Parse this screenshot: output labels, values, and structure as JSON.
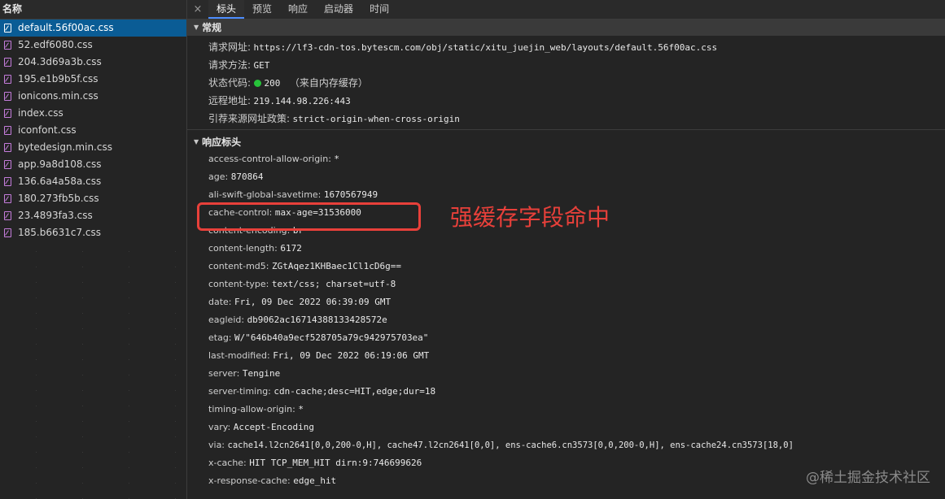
{
  "left_panel": {
    "header": "名称",
    "files": [
      {
        "name": "default.56f00ac.css",
        "selected": true
      },
      {
        "name": "52.edf6080.css"
      },
      {
        "name": "204.3d69a3b.css"
      },
      {
        "name": "195.e1b9b5f.css"
      },
      {
        "name": "ionicons.min.css"
      },
      {
        "name": "index.css"
      },
      {
        "name": "iconfont.css"
      },
      {
        "name": "bytedesign.min.css"
      },
      {
        "name": "app.9a8d108.css"
      },
      {
        "name": "136.6a4a58a.css"
      },
      {
        "name": "180.273fb5b.css"
      },
      {
        "name": "23.4893fa3.css"
      },
      {
        "name": "185.b6631c7.css"
      }
    ]
  },
  "tabs": {
    "close": "×",
    "items": [
      "标头",
      "预览",
      "响应",
      "启动器",
      "时间"
    ],
    "active": "标头"
  },
  "general": {
    "title": "常规",
    "request_url_label": "请求网址:",
    "request_url": "https://lf3-cdn-tos.bytescm.com/obj/static/xitu_juejin_web/layouts/default.56f00ac.css",
    "method_label": "请求方法:",
    "method": "GET",
    "status_label": "状态代码:",
    "status_code": "200",
    "status_note": "（来自内存缓存）",
    "remote_label": "远程地址:",
    "remote": "219.144.98.226:443",
    "referrer_label": "引荐来源网址政策:",
    "referrer": "strict-origin-when-cross-origin"
  },
  "response_headers": {
    "title": "响应标头",
    "rows": [
      {
        "k": "access-control-allow-origin:",
        "v": "*"
      },
      {
        "k": "age:",
        "v": "870864"
      },
      {
        "k": "ali-swift-global-savetime:",
        "v": "1670567949"
      },
      {
        "k": "cache-control:",
        "v": "max-age=31536000"
      },
      {
        "k": "content-encoding:",
        "v": "br"
      },
      {
        "k": "content-length:",
        "v": "6172"
      },
      {
        "k": "content-md5:",
        "v": "ZGtAqez1KHBaec1Cl1cD6g=="
      },
      {
        "k": "content-type:",
        "v": "text/css; charset=utf-8"
      },
      {
        "k": "date:",
        "v": "Fri, 09 Dec 2022 06:39:09 GMT"
      },
      {
        "k": "eagleid:",
        "v": "db9062ac16714388133428572e"
      },
      {
        "k": "etag:",
        "v": "W/\"646b40a9ecf528705a79c942975703ea\""
      },
      {
        "k": "last-modified:",
        "v": "Fri, 09 Dec 2022 06:19:06 GMT"
      },
      {
        "k": "server:",
        "v": "Tengine"
      },
      {
        "k": "server-timing:",
        "v": "cdn-cache;desc=HIT,edge;dur=18"
      },
      {
        "k": "timing-allow-origin:",
        "v": "*"
      },
      {
        "k": "vary:",
        "v": "Accept-Encoding"
      },
      {
        "k": "via:",
        "v": "cache14.l2cn2641[0,0,200-0,H], cache47.l2cn2641[0,0], ens-cache6.cn3573[0,0,200-0,H], ens-cache24.cn3573[18,0]"
      },
      {
        "k": "x-cache:",
        "v": "HIT TCP_MEM_HIT dirn:9:746699626"
      },
      {
        "k": "x-response-cache:",
        "v": "edge_hit"
      }
    ]
  },
  "annotation": "强缓存字段命中",
  "watermark": "@稀土掘金技术社区",
  "colors": {
    "accent": "#e8403a",
    "selected": "#0a5c95",
    "status_ok": "#27c33a"
  }
}
